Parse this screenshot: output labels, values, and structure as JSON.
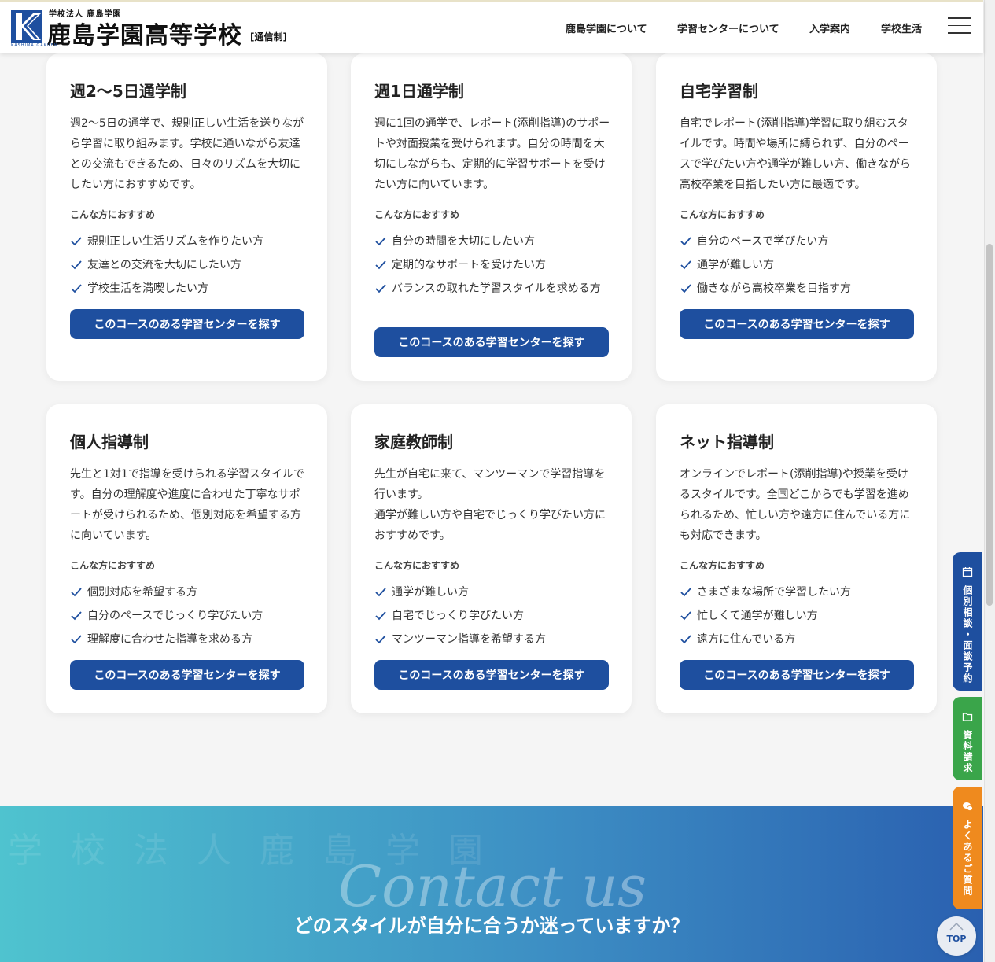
{
  "header": {
    "logo_sub": "学校法人 鹿島学園",
    "logo_main": "鹿島学園高等学校",
    "logo_tag": "[通信制]",
    "logo_en": "KASHIMA GAKUEN",
    "nav": [
      "鹿島学園について",
      "学習センターについて",
      "入学案内",
      "学校生活"
    ],
    "menu_icon": "hamburger-icon"
  },
  "rec_label": "こんな方におすすめ",
  "cta_label": "このコースのある学習センターを探す",
  "courses": [
    {
      "title": "週2〜5日通学制",
      "desc": "週2〜5日の通学で、規則正しい生活を送りながら学習に取り組みます。学校に通いながら友達との交流もできるため、日々のリズムを大切にしたい方におすすめです。",
      "points": [
        "規則正しい生活リズムを作りたい方",
        "友達との交流を大切にしたい方",
        "学校生活を満喫したい方"
      ]
    },
    {
      "title": "週1日通学制",
      "desc": "週に1回の通学で、レポート(添削指導)のサポートや対面授業を受けられます。自分の時間を大切にしながらも、定期的に学習サポートを受けたい方に向いています。",
      "points": [
        "自分の時間を大切にしたい方",
        "定期的なサポートを受けたい方",
        "バランスの取れた学習スタイルを求める方"
      ]
    },
    {
      "title": "自宅学習制",
      "desc": "自宅でレポート(添削指導)学習に取り組むスタイルです。時間や場所に縛られず、自分のペースで学びたい方や通学が難しい方、働きながら高校卒業を目指したい方に最適です。",
      "points": [
        "自分のペースで学びたい方",
        "通学が難しい方",
        "働きながら高校卒業を目指す方"
      ]
    },
    {
      "title": "個人指導制",
      "desc": "先生と1対1で指導を受けられる学習スタイルです。自分の理解度や進度に合わせた丁寧なサポートが受けられるため、個別対応を希望する方に向いています。",
      "points": [
        "個別対応を希望する方",
        "自分のペースでじっくり学びたい方",
        "理解度に合わせた指導を求める方"
      ]
    },
    {
      "title": "家庭教師制",
      "desc": "先生が自宅に来て、マンツーマンで学習指導を行います。",
      "desc2": "通学が難しい方や自宅でじっくり学びたい方におすすめです。",
      "points": [
        "通学が難しい方",
        "自宅でじっくり学びたい方",
        "マンツーマン指導を希望する方"
      ]
    },
    {
      "title": "ネット指導制",
      "desc": "オンラインでレポート(添削指導)や授業を受けるスタイルです。全国どこからでも学習を進められるため、忙しい方や遠方に住んでいる方にも対応できます。",
      "points": [
        "さまざまな場所で学習したい方",
        "忙しくて通学が難しい方",
        "遠方に住んでいる方"
      ]
    }
  ],
  "side_tabs": [
    {
      "label": "個別相談・面談予約",
      "color": "#1e4f9f",
      "icon": "calendar-icon"
    },
    {
      "label": "資料請求",
      "color": "#3aa54a",
      "icon": "folder-icon"
    },
    {
      "label": "よくあるご質問",
      "color": "#ef8a1e",
      "icon": "chat-icon"
    }
  ],
  "contact": {
    "bg_text": "学校法人鹿島学園",
    "script": "Contact us",
    "heading": "どのスタイルが自分に合うか迷っていますか？"
  },
  "top_button": "TOP"
}
